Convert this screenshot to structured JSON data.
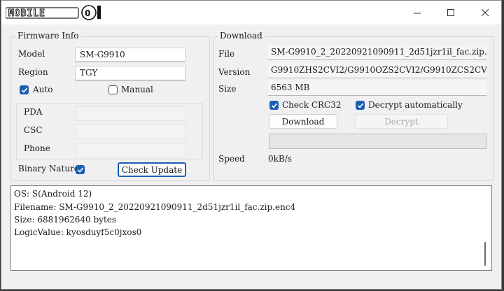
{
  "window": {
    "logo_text": "MOBILE01",
    "controls": {
      "minimize": "minimize-icon",
      "maximize": "maximize-icon",
      "close": "close-icon"
    }
  },
  "firmware": {
    "title": "Firmware Info",
    "model_label": "Model",
    "model_value": "SM-G9910",
    "region_label": "Region",
    "region_value": "TGY",
    "auto_label": "Auto",
    "auto_checked": true,
    "manual_label": "Manual",
    "manual_checked": false,
    "pda_label": "PDA",
    "pda_value": "",
    "csc_label": "CSC",
    "csc_value": "",
    "phone_label": "Phone",
    "phone_value": "",
    "binary_label": "Binary Nature",
    "binary_checked": true,
    "check_update_label": "Check Update"
  },
  "download": {
    "title": "Download",
    "file_label": "File",
    "file_value": "SM-G9910_2_20220921090911_2d51jzr1il_fac.zip.enc4",
    "version_label": "Version",
    "version_value": "G9910ZHS2CVI2/G9910OZS2CVI2/G9910ZCS2CVI2/G99",
    "size_label": "Size",
    "size_value": "6563 MB",
    "crc_label": "Check CRC32",
    "crc_checked": true,
    "decrypt_auto_label": "Decrypt automatically",
    "decrypt_auto_checked": true,
    "download_btn": "Download",
    "decrypt_btn": "Decrypt",
    "progress": 0,
    "speed_label": "Speed",
    "speed_value": "0kB/s"
  },
  "log": {
    "lines": [
      "OS: S(Android 12)",
      "Filename: SM-G9910_2_20220921090911_2d51jzr1il_fac.zip.enc4",
      "Size: 6881962640 bytes",
      "LogicValue: kyosduyf5c0jxos0"
    ]
  },
  "colors": {
    "accent": "#1a5fb4",
    "progress": "#06b025"
  }
}
